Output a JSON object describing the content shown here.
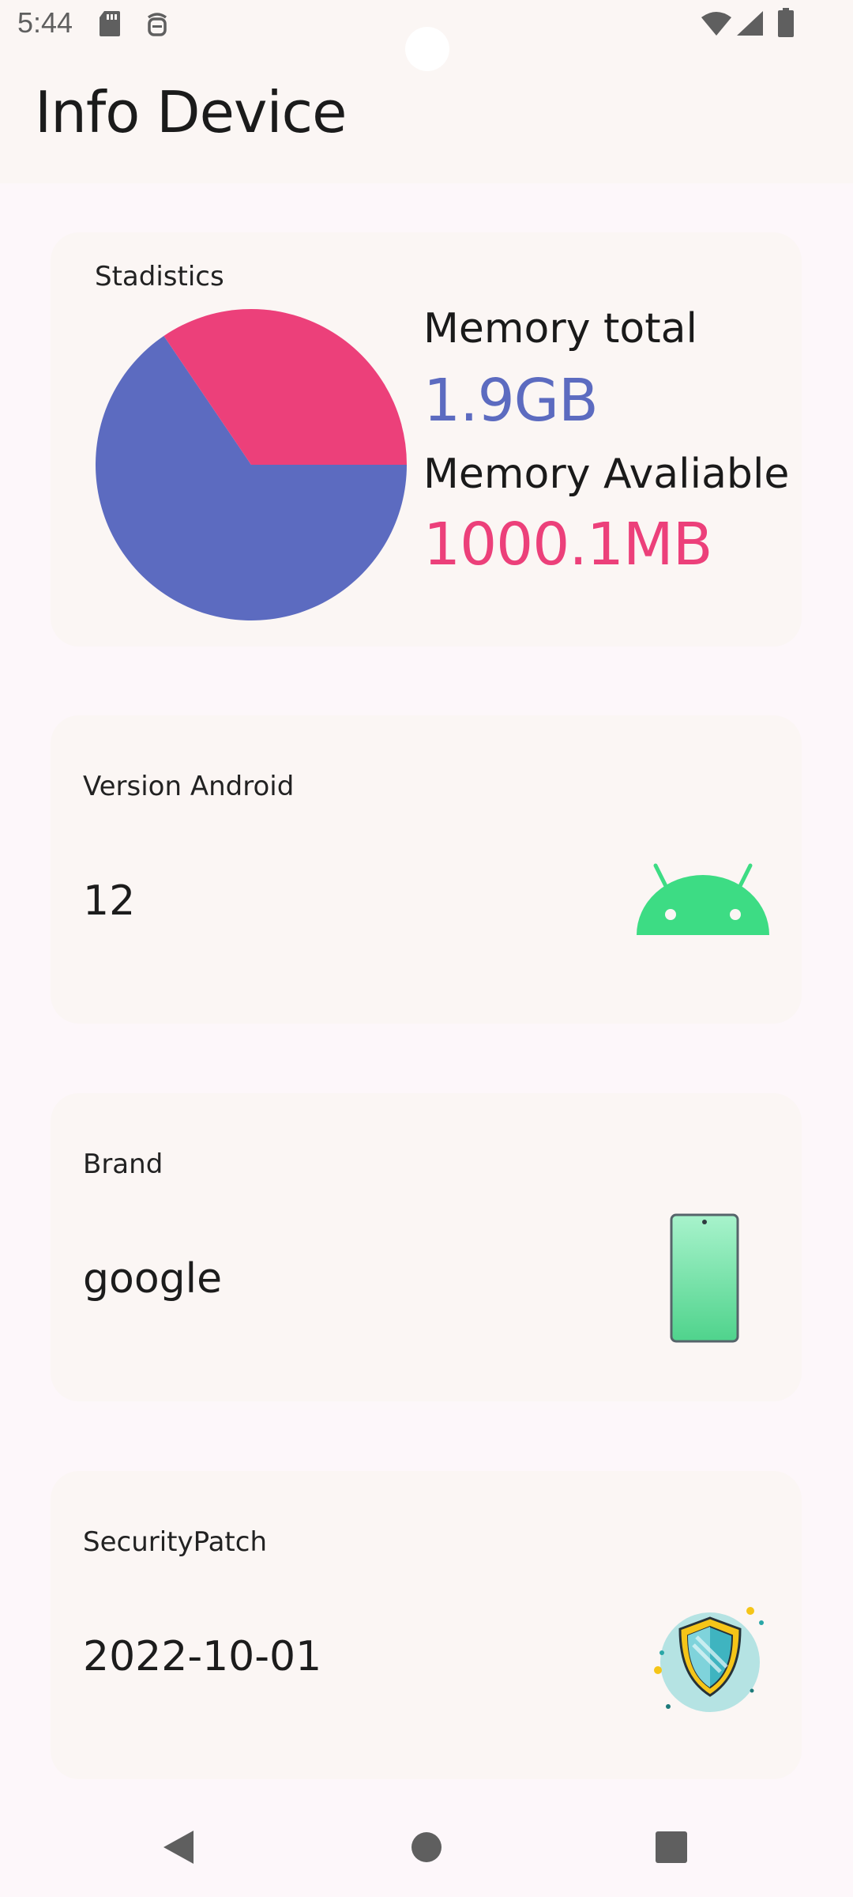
{
  "status_bar": {
    "time": "5:44",
    "icons": [
      "sd-card-icon",
      "debug-icon",
      "wifi-icon",
      "signal-icon",
      "battery-icon"
    ]
  },
  "app_bar": {
    "title": "Info Device"
  },
  "statistics": {
    "label": "Stadistics",
    "memory_total_label": "Memory total",
    "memory_total_value": "1.9GB",
    "memory_available_label": "Memory Avaliable",
    "memory_available_value": "1000.1MB",
    "chart_data": {
      "type": "pie",
      "slices": [
        {
          "label": "Memory total",
          "value": 1.9,
          "color": "#5c6bc0"
        },
        {
          "label": "Memory Avaliable",
          "value": 1.0001,
          "color": "#ec407a"
        }
      ]
    }
  },
  "version_card": {
    "label": "Version Android",
    "value": "12",
    "icon": "android-icon"
  },
  "brand_card": {
    "label": "Brand",
    "value": "google",
    "icon": "phone-icon"
  },
  "security_card": {
    "label": "SecurityPatch",
    "value": "2022-10-01",
    "icon": "shield-icon"
  },
  "colors": {
    "accent_blue": "#5c6bc0",
    "accent_pink": "#ec407a",
    "android_green": "#3ddc84"
  },
  "nav_bar": {
    "buttons": [
      "back-icon",
      "home-icon",
      "recents-icon"
    ]
  }
}
